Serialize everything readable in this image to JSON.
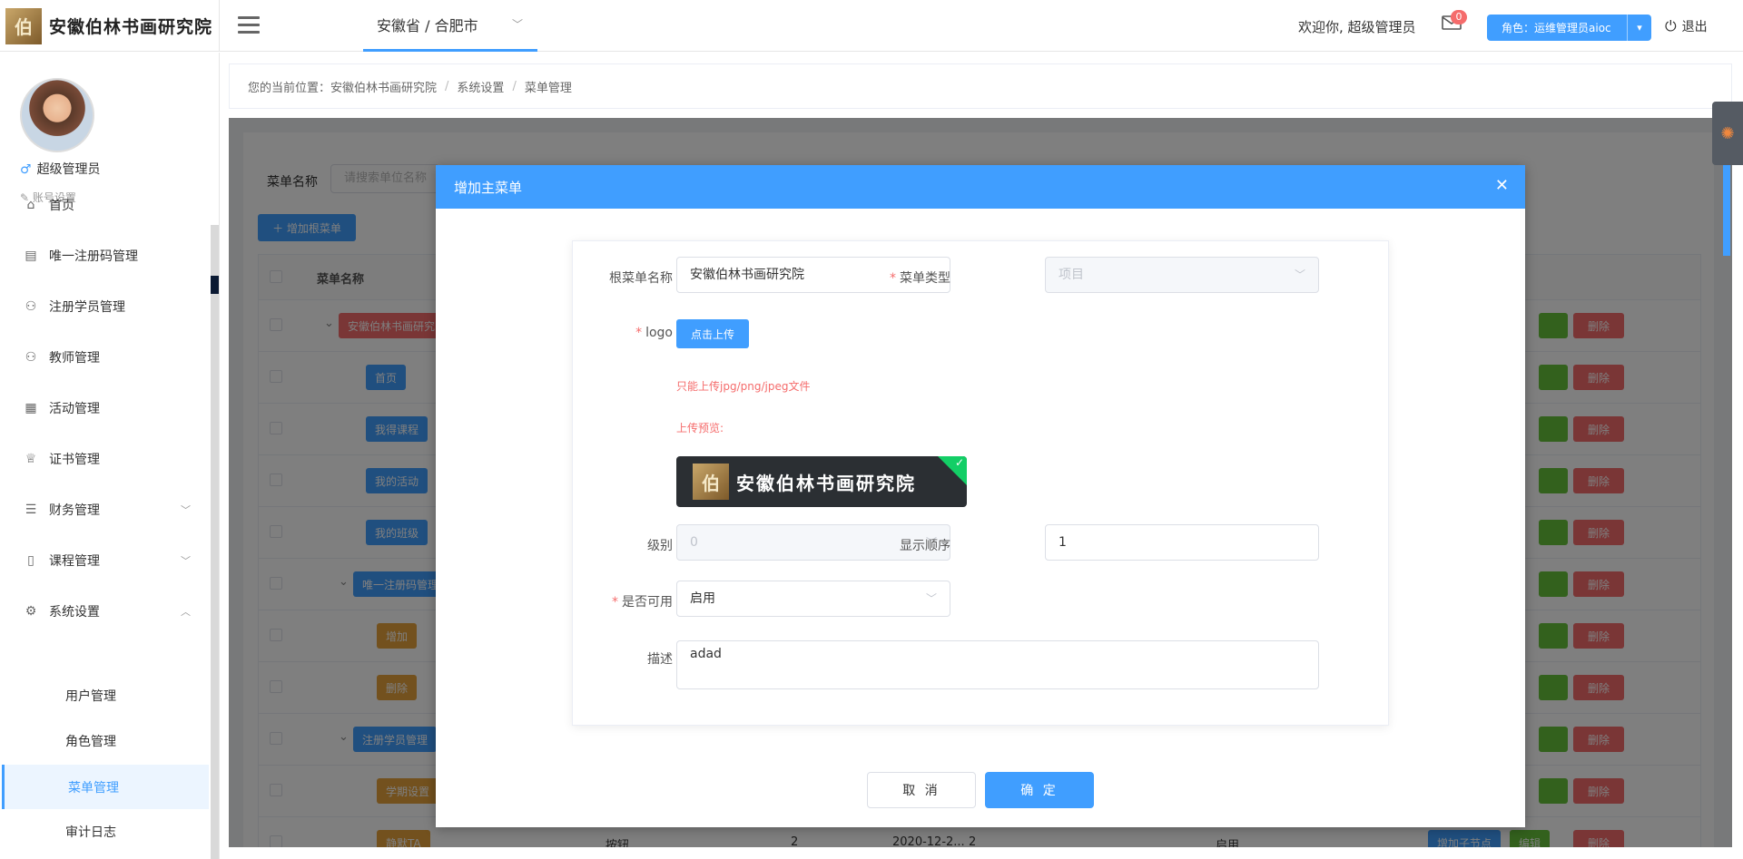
{
  "header": {
    "logo_text": "安徽伯林书画研究院",
    "logo_mark": "伯",
    "region": "安徽省 / 合肥市",
    "welcome": "欢迎你, 超级管理员",
    "mail_count": "0",
    "role_label": "角色：运维管理员aioc",
    "logout": "退出"
  },
  "sidebar": {
    "user_name": "超级管理员",
    "gender_symbol": "♂",
    "account_settings": "账号设置",
    "items": [
      {
        "label": "首页",
        "icon": "home-icon",
        "glyph": "⌂"
      },
      {
        "label": "唯一注册码管理",
        "icon": "document-icon",
        "glyph": "▤"
      },
      {
        "label": "注册学员管理",
        "icon": "user-icon",
        "glyph": "⚇"
      },
      {
        "label": "教师管理",
        "icon": "user-icon",
        "glyph": "⚇"
      },
      {
        "label": "活动管理",
        "icon": "gift-icon",
        "glyph": "▦"
      },
      {
        "label": "证书管理",
        "icon": "trophy-icon",
        "glyph": "♕"
      },
      {
        "label": "财务管理",
        "icon": "coins-icon",
        "glyph": "☰"
      },
      {
        "label": "课程管理",
        "icon": "book-icon",
        "glyph": "▯"
      },
      {
        "label": "系统设置",
        "icon": "settings-icon",
        "glyph": "⚙"
      }
    ],
    "sub_items": [
      "用户管理",
      "角色管理",
      "菜单管理",
      "审计日志"
    ]
  },
  "breadcrumb": {
    "prefix": "您的当前位置：",
    "items": [
      "安徽伯林书画研究院",
      "系统设置",
      "菜单管理"
    ]
  },
  "page": {
    "search_label": "菜单名称",
    "search_placeholder": "请搜索单位名称",
    "add_root": "＋ 增加根菜单",
    "col_name": "菜单名称",
    "rows": [
      {
        "name": "安徽伯林书画研究院",
        "color": "red"
      },
      {
        "name": "首页",
        "color": "blue"
      },
      {
        "name": "我得课程",
        "color": "blue"
      },
      {
        "name": "我的活动",
        "color": "blue"
      },
      {
        "name": "我的班级",
        "color": "blue"
      },
      {
        "name": "唯一注册码管理",
        "color": "blue"
      },
      {
        "name": "增加",
        "color": "orange"
      },
      {
        "name": "删除",
        "color": "orange"
      },
      {
        "name": "注册学员管理",
        "color": "blue"
      },
      {
        "name": "学期设置",
        "color": "orange"
      },
      {
        "name": "静默TA",
        "color": "orange"
      }
    ],
    "delete_label": "删除",
    "last_row": {
      "type": "按钮",
      "level": "2",
      "date": "2020-12-2...",
      "order": "2",
      "status": "启用",
      "add_child": "增加子节点",
      "edit": "编辑"
    }
  },
  "dialog": {
    "title": "增加主菜单",
    "root_name_label": "根菜单名称",
    "root_name_value": "安徽伯林书画研究院",
    "menu_type_label": "菜单类型",
    "menu_type_value": "项目",
    "logo_label": "logo",
    "upload_button": "点击上传",
    "upload_tip": "只能上传jpg/png/jpeg文件",
    "preview_label": "上传预览:",
    "preview_text": "安徽伯林书画研究院",
    "level_label": "级别",
    "level_value": "0",
    "order_label": "显示顺序",
    "order_value": "1",
    "enabled_label": "是否可用",
    "enabled_value": "启用",
    "desc_label": "描述",
    "desc_value": "adad",
    "cancel": "取 消",
    "confirm": "确 定"
  },
  "colors": {
    "primary": "#409eff",
    "danger": "#f56c6c",
    "success": "#67c23a",
    "warning": "#e6a23c"
  }
}
